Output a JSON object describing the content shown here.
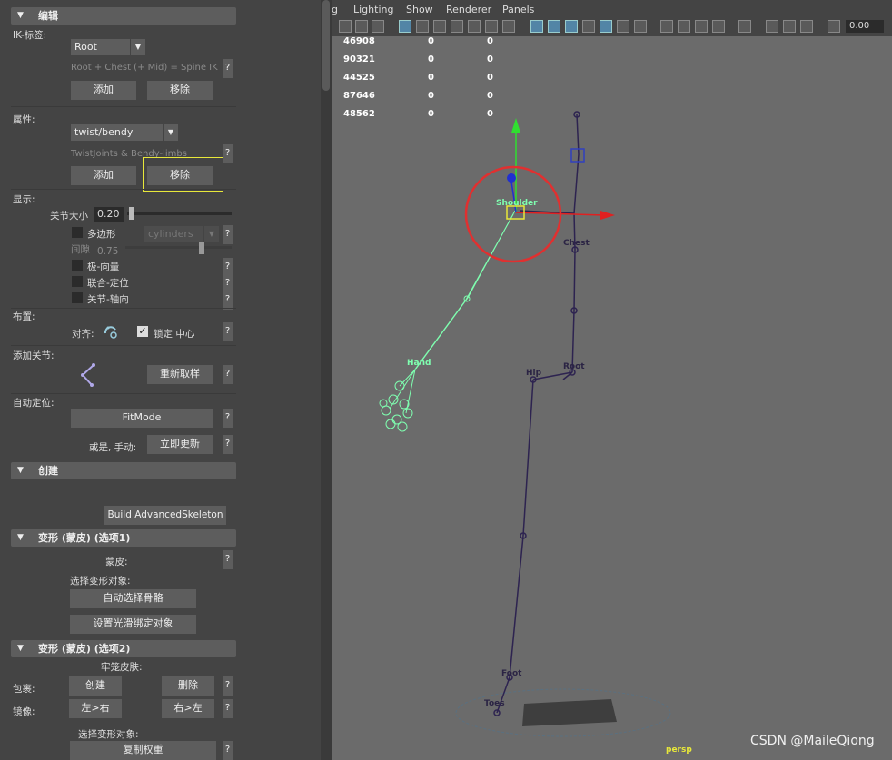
{
  "panel": {
    "edit_header": "编辑",
    "ik_label": "IK-标签:",
    "ik_value": "Root",
    "ik_hint": "Root + Chest (+ Mid) = Spine IK",
    "add": "添加",
    "remove": "移除",
    "attr_label": "属性:",
    "attr_value": "twist/bendy",
    "attr_hint": "TwistJoints & Bendy-limbs",
    "display_label": "显示:",
    "joint_size_label": "关节大小",
    "joint_size_value": "0.20",
    "polygon_label": "多边形",
    "polygon_option": "cylinders",
    "gap_label": "间隙",
    "gap_value": "0.75",
    "pole_vector": "极-向量",
    "fit_locate": "联合-定位",
    "joint_axis": "关节-轴向",
    "layout_label": "布置:",
    "align_label": "对齐:",
    "lock_center": "锁定 中心",
    "add_joint_label": "添加关节:",
    "resample": "重新取样",
    "auto_locate_label": "自动定位:",
    "fitmode": "FitMode",
    "or_manual": "或是, 手动:",
    "update_now": "立即更新",
    "create_header": "创建",
    "build_button": "Build AdvancedSkeleton",
    "deform1_header": "变形 (蒙皮) (选项1)",
    "skin_label": "蒙皮:",
    "select_deform_label": "选择变形对象:",
    "auto_select_bones": "自动选择骨骼",
    "set_smooth_bind": "设置光滑绑定对象",
    "deform2_header": "变形 (蒙皮) (选项2)",
    "cage_label": "牢笼皮肤:",
    "wrap_label": "包裹:",
    "create": "创建",
    "delete": "删除",
    "mirror_label": "镜像:",
    "left_to_right": "左>右",
    "right_to_left": "右>左",
    "select_deform_label2": "选择变形对象:",
    "copy_weights": "复制权重",
    "help": "?"
  },
  "viewport": {
    "menu": [
      "g",
      "Lighting",
      "Show",
      "Renderer",
      "Panels"
    ],
    "zoom_value": "0.00",
    "stats": [
      [
        "46908",
        "0",
        "0"
      ],
      [
        "90321",
        "0",
        "0"
      ],
      [
        "44525",
        "0",
        "0"
      ],
      [
        "87646",
        "0",
        "0"
      ],
      [
        "48562",
        "0",
        "0"
      ]
    ],
    "joints": {
      "shoulder": "Shoulder",
      "chest": "Chest",
      "hand": "Hand",
      "hip": "Hip",
      "root": "Root",
      "foot": "Foot",
      "toes": "Toes"
    },
    "camera": "persp",
    "watermark": "CSDN @MaileQiong"
  }
}
